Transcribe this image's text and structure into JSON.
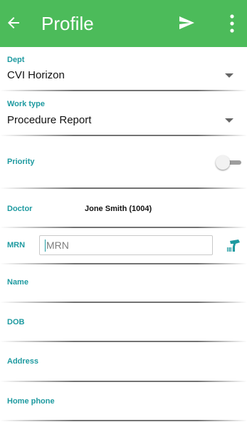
{
  "appbar": {
    "title": "Profile",
    "icons": {
      "back": "arrow-left-icon",
      "send": "send-icon",
      "more": "more-vert-icon"
    },
    "color": "#4cbb5a"
  },
  "form": {
    "dept": {
      "label": "Dept",
      "value": "CVI Horizon"
    },
    "work_type": {
      "label": "Work type",
      "value": "Procedure Report"
    },
    "priority": {
      "label": "Priority",
      "toggle_on": false
    },
    "doctor": {
      "label": "Doctor",
      "value": "Jone Smith (1004)"
    },
    "mrn": {
      "label": "MRN",
      "placeholder": "MRN",
      "value": "",
      "scan_icon": "barcode-scanner-icon"
    },
    "name": {
      "label": "Name"
    },
    "dob": {
      "label": "DOB"
    },
    "address": {
      "label": "Address"
    },
    "home_phone": {
      "label": "Home phone"
    }
  },
  "colors": {
    "label": "#1e9aa0",
    "accent": "#1e9aa0"
  }
}
